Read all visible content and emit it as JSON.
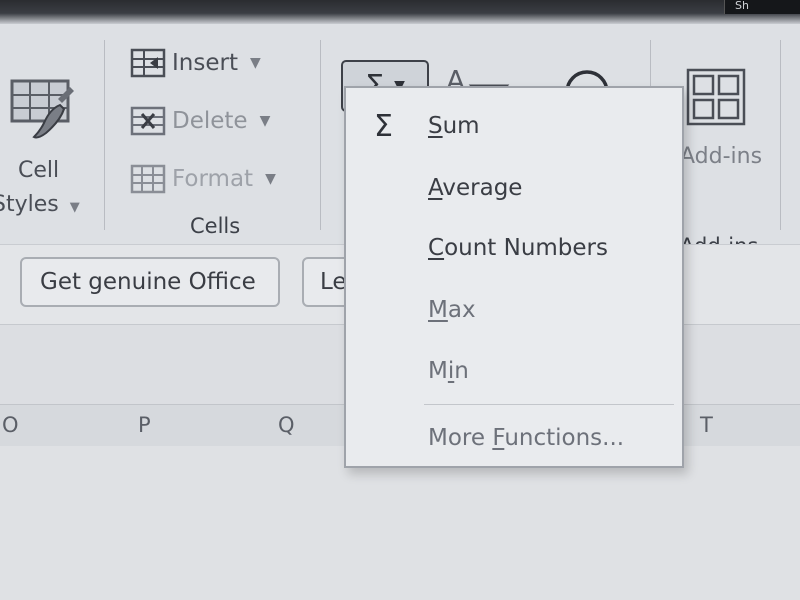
{
  "window": {
    "corner_glyph": "Sh"
  },
  "ribbon": {
    "cell_styles": {
      "line1": "Cell",
      "line2": "Styles",
      "icon": "cell-styles-brush-icon"
    },
    "cells_group": {
      "insert": "Insert",
      "delete": "Delete",
      "format": "Format",
      "label": "Cells"
    },
    "editing": {
      "autosum_symbol": "Σ",
      "sort_filter_icon": "sort-filter-icon",
      "find_select_icon": "find-select-icon"
    },
    "addins": {
      "button_label": "Add-ins",
      "group_label": "Add-ins",
      "icon": "addins-grid-icon"
    }
  },
  "notification": {
    "get_genuine_office": "Get genuine Office",
    "learn_more_partial": "Le"
  },
  "column_headers": [
    "O",
    "P",
    "Q",
    "T"
  ],
  "autosum_menu": {
    "items": [
      {
        "symbol": "Σ",
        "label": "Sum",
        "access_key": "S",
        "rest": "um"
      },
      {
        "symbol": "",
        "label": "Average",
        "access_key": "A",
        "rest": "verage"
      },
      {
        "symbol": "",
        "label": "Count Numbers",
        "access_key": "C",
        "rest": "ount Numbers"
      },
      {
        "symbol": "",
        "label": "Max",
        "access_key": "M",
        "rest": "ax"
      },
      {
        "symbol": "",
        "label": "Min",
        "pre": "M",
        "access_key": "i",
        "rest": "n"
      },
      {
        "symbol": "",
        "label": "More Functions...",
        "pre": "More ",
        "access_key": "F",
        "rest": "unctions..."
      }
    ]
  },
  "colors": {
    "ribbon_bg": "#dde0e4",
    "menu_bg": "#e9ebee",
    "menu_border": "#9fa3aa",
    "text": "#3a3d44"
  }
}
